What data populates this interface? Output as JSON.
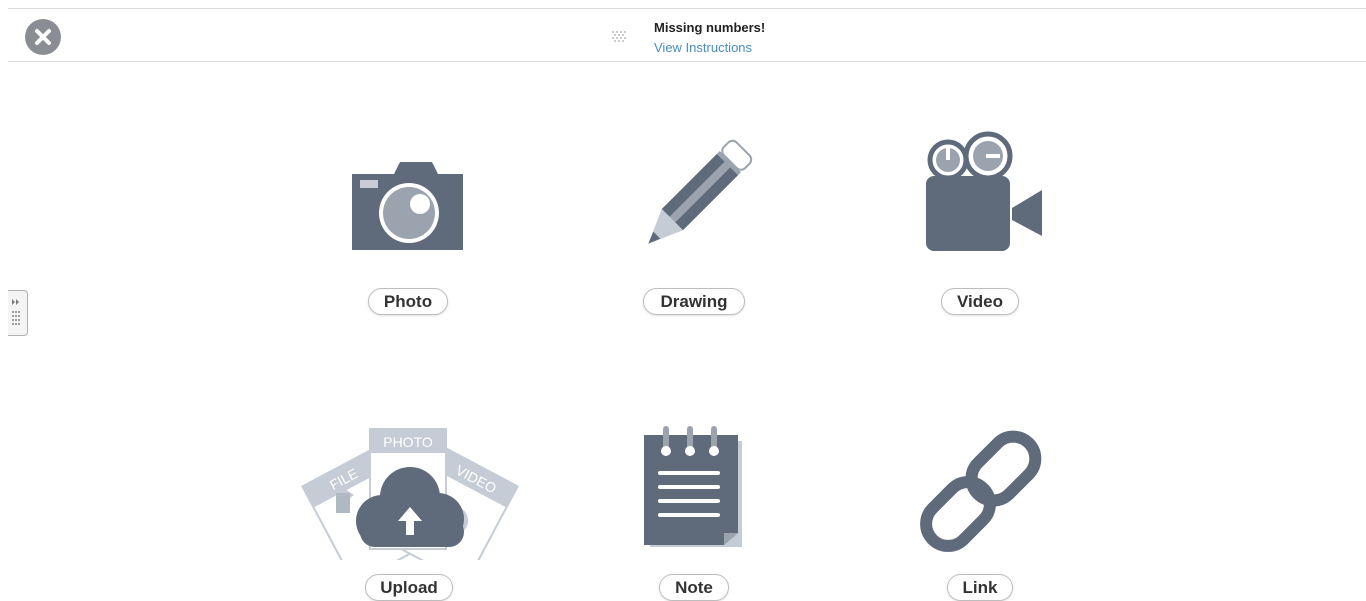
{
  "assignment": {
    "title": "Missing numbers!",
    "instructions_link": "View Instructions"
  },
  "icons": {
    "close": "close-icon",
    "grip": "drag-handle-icon",
    "side_tab": "expand-panel-icon"
  },
  "tools": [
    {
      "label": "Photo",
      "icon": "camera-icon"
    },
    {
      "label": "Drawing",
      "icon": "pencil-icon"
    },
    {
      "label": "Video",
      "icon": "video-camera-icon"
    },
    {
      "label": "Upload",
      "icon": "cloud-upload-icon",
      "art_labels": [
        "FILE",
        "PHOTO",
        "VIDEO"
      ]
    },
    {
      "label": "Note",
      "icon": "notepad-icon"
    },
    {
      "label": "Link",
      "icon": "chain-link-icon"
    }
  ],
  "colors": {
    "icon_primary": "#5f6b7b",
    "icon_light": "#c5ccd6",
    "link": "#4a8ec2",
    "close_button": "#8a8e94"
  }
}
